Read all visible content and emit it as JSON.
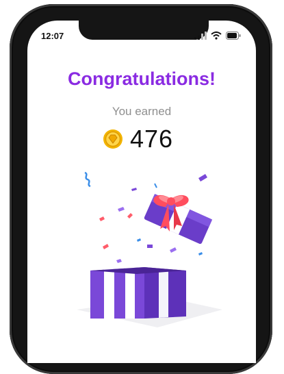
{
  "status_bar": {
    "time": "12:07",
    "icons": [
      "signal-icon",
      "wifi-icon",
      "battery-icon"
    ]
  },
  "reward": {
    "title": "Congratulations!",
    "subtitle": "You earned",
    "amount": "476",
    "coin_icon": "coin-icon"
  },
  "illustration": {
    "icon": "gift-box-icon"
  },
  "colors": {
    "title": "#8a2be2",
    "gift": "#7b45d6",
    "ribbon": "#ff4d5e",
    "coin": "#f4b400"
  }
}
